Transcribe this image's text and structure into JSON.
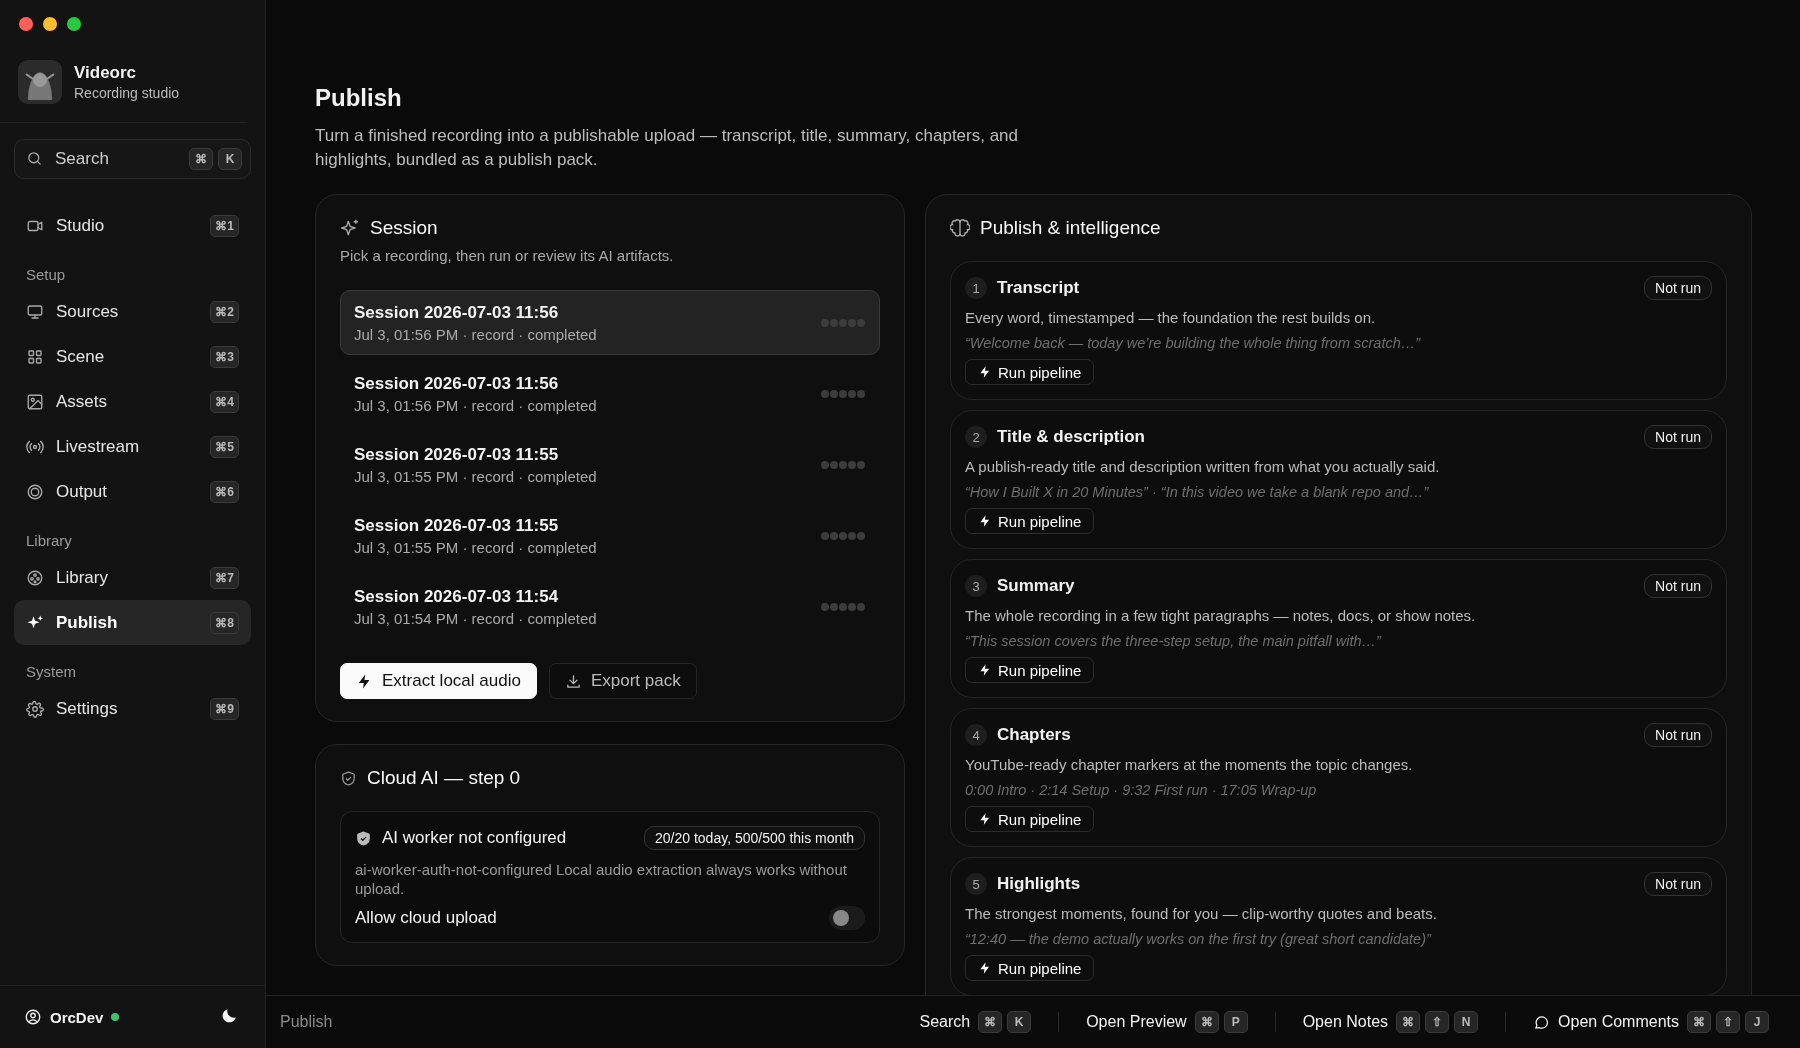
{
  "app": {
    "name": "Videorc",
    "subtitle": "Recording studio"
  },
  "search": {
    "placeholder": "Search",
    "keys": [
      "⌘",
      "K"
    ]
  },
  "nav": [
    {
      "items": [
        {
          "label": "Studio",
          "shortcut": "⌘1",
          "selected": false
        }
      ]
    },
    {
      "heading": "Setup",
      "items": [
        {
          "label": "Sources",
          "shortcut": "⌘2",
          "selected": false
        },
        {
          "label": "Scene",
          "shortcut": "⌘3",
          "selected": false
        },
        {
          "label": "Assets",
          "shortcut": "⌘4",
          "selected": false
        },
        {
          "label": "Livestream",
          "shortcut": "⌘5",
          "selected": false
        },
        {
          "label": "Output",
          "shortcut": "⌘6",
          "selected": false
        }
      ]
    },
    {
      "heading": "Library",
      "items": [
        {
          "label": "Library",
          "shortcut": "⌘7",
          "selected": false
        },
        {
          "label": "Publish",
          "shortcut": "⌘8",
          "selected": true
        }
      ]
    },
    {
      "heading": "System",
      "items": [
        {
          "label": "Settings",
          "shortcut": "⌘9",
          "selected": false
        }
      ]
    }
  ],
  "user": {
    "name": "OrcDev",
    "online": true
  },
  "page": {
    "title": "Publish",
    "description": "Turn a finished recording into a publishable upload — transcript, title, summary, chapters, and highlights, bundled as a publish pack."
  },
  "session_panel": {
    "title": "Session",
    "subtitle": "Pick a recording, then run or review its AI artifacts.",
    "sessions": [
      {
        "title": "Session 2026-07-03 11:56",
        "meta": "Jul 3, 01:56 PM · record · completed",
        "selected": true
      },
      {
        "title": "Session 2026-07-03 11:56",
        "meta": "Jul 3, 01:56 PM · record · completed",
        "selected": false
      },
      {
        "title": "Session 2026-07-03 11:55",
        "meta": "Jul 3, 01:55 PM · record · completed",
        "selected": false
      },
      {
        "title": "Session 2026-07-03 11:55",
        "meta": "Jul 3, 01:55 PM · record · completed",
        "selected": false
      },
      {
        "title": "Session 2026-07-03 11:54",
        "meta": "Jul 3, 01:54 PM · record · completed",
        "selected": false
      }
    ],
    "actions": [
      {
        "label": "Extract local audio",
        "kind": "primary"
      },
      {
        "label": "Export pack",
        "kind": "secondary"
      }
    ]
  },
  "cloud_panel": {
    "title": "Cloud AI — step 0",
    "status": {
      "title": "AI worker not configured",
      "quota": "20/20 today, 500/500 this month",
      "message": "ai-worker-auth-not-configured Local audio extraction always works without upload."
    },
    "toggle": {
      "label": "Allow cloud upload",
      "on": false
    }
  },
  "publish_panel": {
    "title": "Publish & intelligence",
    "steps": [
      {
        "number": "1",
        "title": "Transcript",
        "status": "Not run",
        "description": "Every word, timestamped — the foundation the rest builds on.",
        "sample": "“Welcome back — today we’re building the whole thing from scratch…”",
        "action": "Run pipeline"
      },
      {
        "number": "2",
        "title": "Title & description",
        "status": "Not run",
        "description": "A publish-ready title and description written from what you actually said.",
        "sample": "“How I Built X in 20 Minutes” · “In this video we take a blank repo and…”",
        "action": "Run pipeline"
      },
      {
        "number": "3",
        "title": "Summary",
        "status": "Not run",
        "description": "The whole recording in a few tight paragraphs — notes, docs, or show notes.",
        "sample": "“This session covers the three-step setup, the main pitfall with…”",
        "action": "Run pipeline"
      },
      {
        "number": "4",
        "title": "Chapters",
        "status": "Not run",
        "description": "YouTube-ready chapter markers at the moments the topic changes.",
        "sample": "0:00 Intro · 2:14 Setup · 9:32 First run · 17:05 Wrap-up",
        "action": "Run pipeline"
      },
      {
        "number": "5",
        "title": "Highlights",
        "status": "Not run",
        "description": "The strongest moments, found for you — clip-worthy quotes and beats.",
        "sample": "“12:40 — the demo actually works on the first try (great short candidate)”",
        "action": "Run pipeline"
      }
    ]
  },
  "status_bar": {
    "location": "Publish",
    "shortcuts": [
      {
        "label": "Search",
        "keys": [
          "⌘",
          "K"
        ]
      },
      {
        "label": "Open Preview",
        "keys": [
          "⌘",
          "P"
        ]
      },
      {
        "label": "Open Notes",
        "keys": [
          "⌘",
          "⇧",
          "N"
        ]
      },
      {
        "label": "Open Comments",
        "keys": [
          "⌘",
          "⇧",
          "J"
        ]
      }
    ]
  }
}
